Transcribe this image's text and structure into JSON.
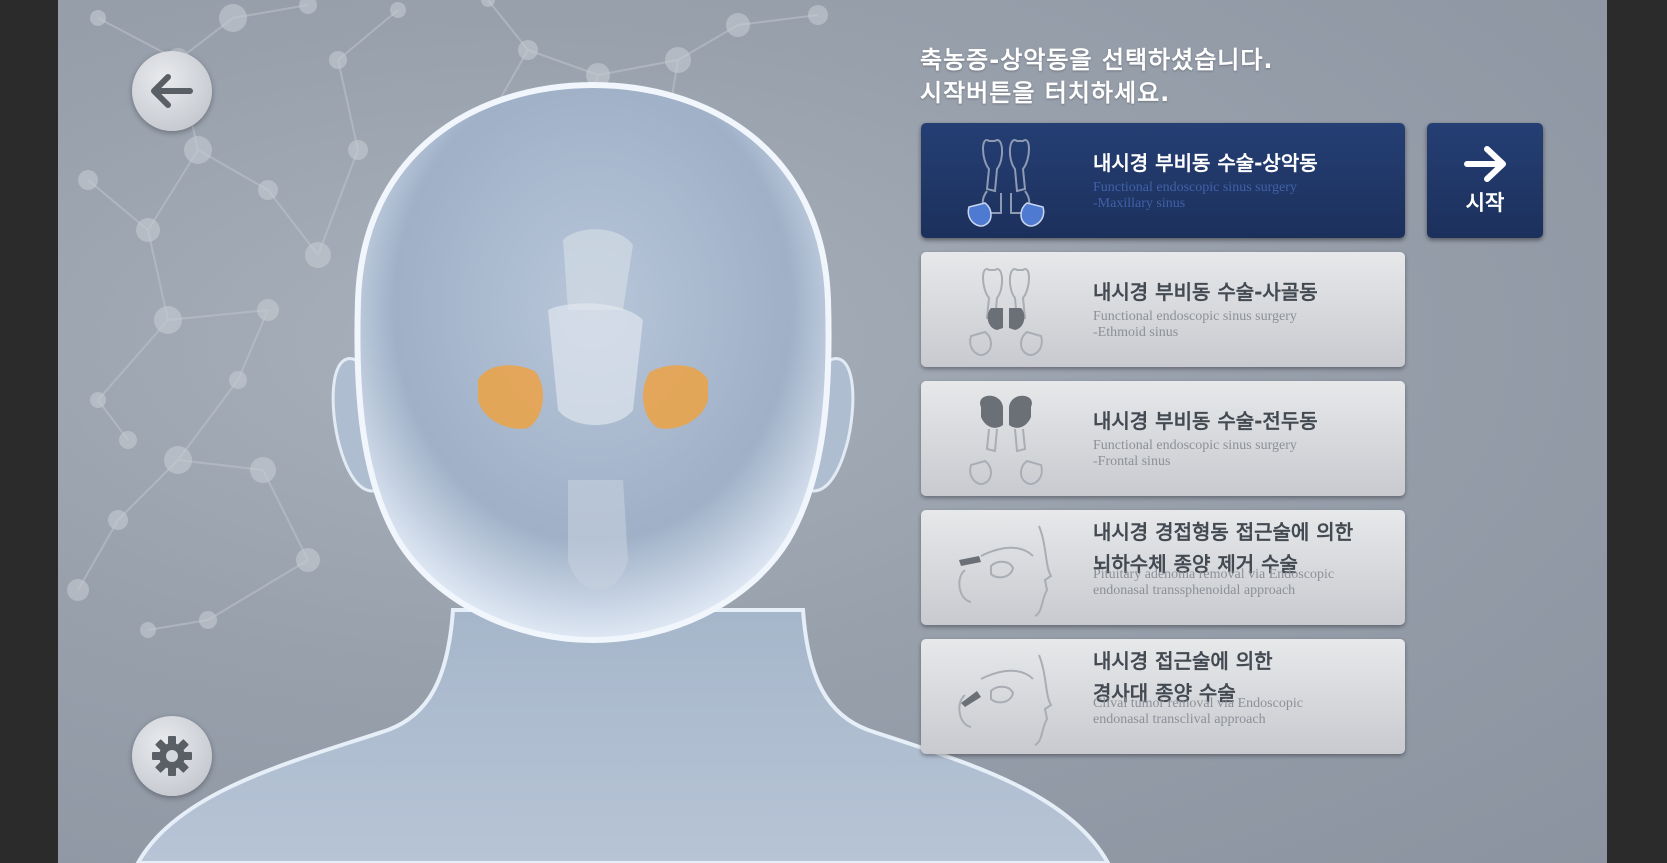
{
  "instruction": {
    "line1": "축농증-상악동을  선택하셨습니다.",
    "line2": "시작버튼을  터치하세요."
  },
  "procedures": [
    {
      "title": "내시경 부비동 수술-상악동",
      "subtitle_line1": "Functional endoscopic sinus surgery",
      "subtitle_line2": "-Maxillary sinus",
      "selected": true
    },
    {
      "title": "내시경 부비동 수술-사골동",
      "subtitle_line1": "Functional endoscopic sinus surgery",
      "subtitle_line2": "-Ethmoid sinus",
      "selected": false
    },
    {
      "title": "내시경 부비동 수술-전두동",
      "subtitle_line1": "Functional endoscopic sinus surgery",
      "subtitle_line2": "-Frontal sinus",
      "selected": false
    },
    {
      "title_line1": "내시경 경접형동 접근술에 의한",
      "title_line2": "뇌하수체 종양 제거 수술",
      "subtitle_line1": "Pituitary adenoma removal via Endoscopic",
      "subtitle_line2": "endonasal transsphenoidal approach",
      "selected": false
    },
    {
      "title_line1": "내시경 접근술에 의한",
      "title_line2": "경사대 종양 수술",
      "subtitle_line1": "Clival tumor removal  via Endoscopic",
      "subtitle_line2": "endonasal transclival approach",
      "selected": false
    }
  ],
  "start_button": {
    "label": "시작",
    "icon": "arrow-right-icon"
  },
  "back_button": {
    "icon": "arrow-left-icon"
  },
  "settings_button": {
    "icon": "gear-icon"
  },
  "colors": {
    "selected_card": "#1c305c",
    "highlight_sinus": "#e7a44f",
    "background": "#98a0ac"
  }
}
